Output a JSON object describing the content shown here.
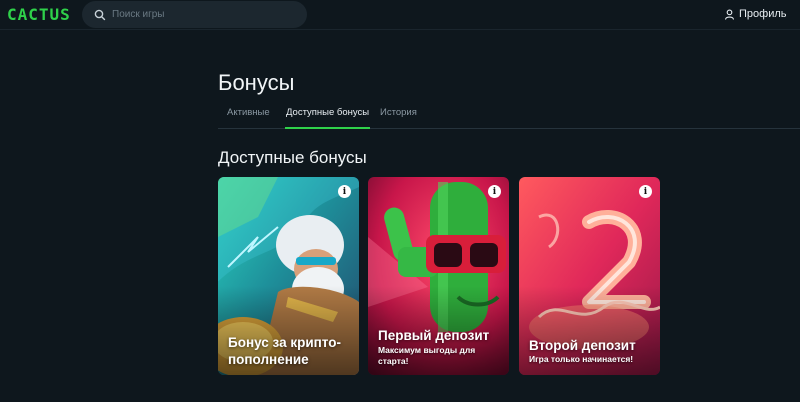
{
  "header": {
    "logo": "CACTUS",
    "search": {
      "placeholder": "Поиск игры",
      "value": ""
    },
    "profile_label": "Профиль"
  },
  "page": {
    "title": "Бонусы",
    "tabs": [
      {
        "label": "Активные",
        "active": false
      },
      {
        "label": "Доступные бонусы",
        "active": true
      },
      {
        "label": "История",
        "active": false
      }
    ],
    "section_title": "Доступные бонусы"
  },
  "cards": [
    {
      "title": "Бонус за крипто-пополнение",
      "subtitle": "",
      "info_icon": "i"
    },
    {
      "title": "Первый депозит",
      "subtitle": "Максимум выгоды для старта!",
      "info_icon": "i"
    },
    {
      "title": "Второй депозит",
      "subtitle": "Игра только начинается!",
      "info_icon": "i"
    }
  ],
  "colors": {
    "background": "#0e171d",
    "accent": "#2fd14a",
    "search_bg": "#1c272f"
  }
}
